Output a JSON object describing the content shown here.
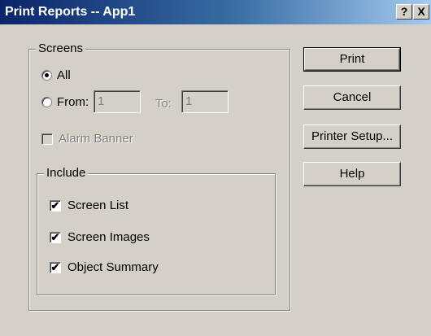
{
  "window": {
    "title": "Print Reports -- App1",
    "help_glyph": "?",
    "close_glyph": "X"
  },
  "screens": {
    "legend": "Screens",
    "all_label": "All",
    "from_label": "From:",
    "from_value": "1",
    "to_label": "To:",
    "to_value": "1",
    "selected": "All"
  },
  "alarm_banner": {
    "label": "Alarm Banner",
    "checked": false,
    "enabled": false
  },
  "include": {
    "legend": "Include",
    "items": [
      {
        "label": "Screen List",
        "checked": true
      },
      {
        "label": "Screen Images",
        "checked": true
      },
      {
        "label": "Object Summary",
        "checked": true
      }
    ]
  },
  "buttons": {
    "print": "Print",
    "cancel": "Cancel",
    "printer_setup": "Printer Setup...",
    "help": "Help"
  },
  "check_glyph": "✔"
}
